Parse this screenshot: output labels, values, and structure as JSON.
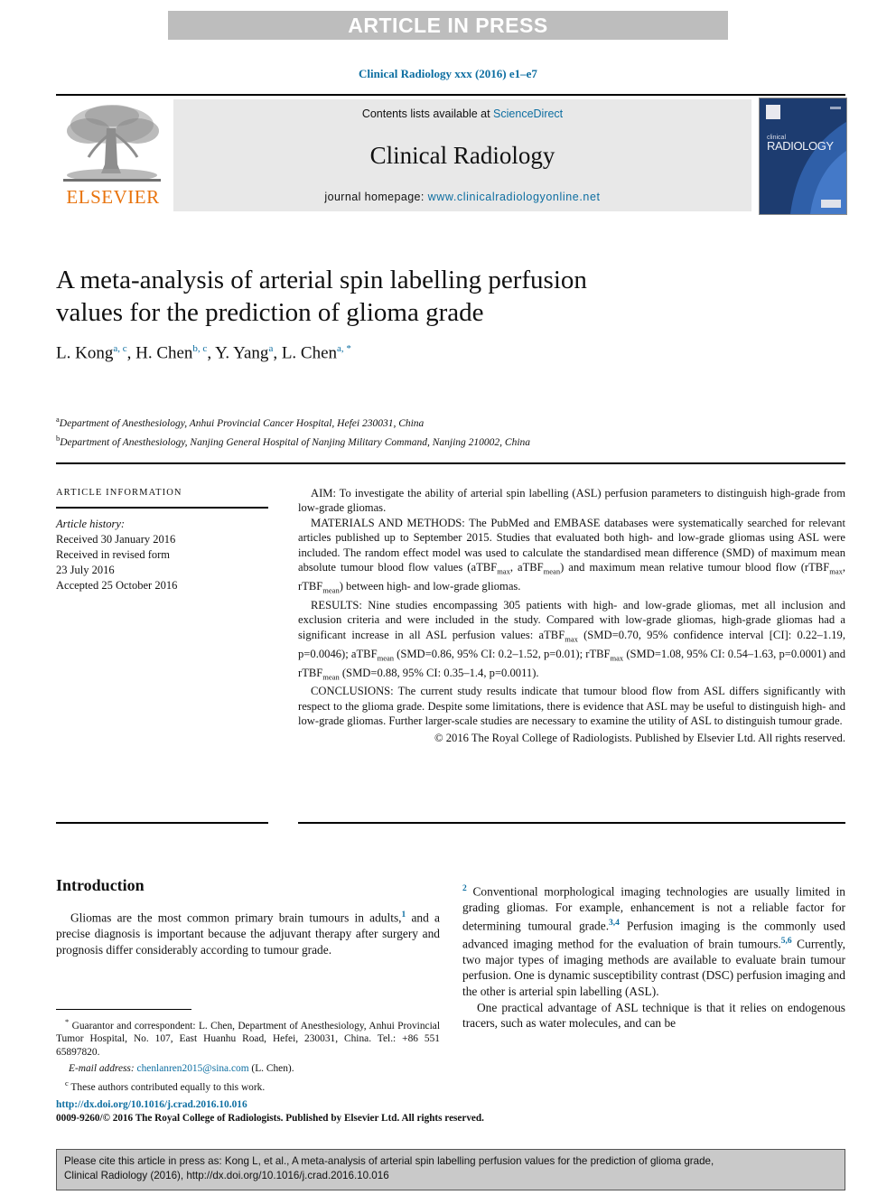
{
  "banner": {
    "label": "ARTICLE IN PRESS"
  },
  "running_head": "Clinical Radiology xxx (2016) e1–e7",
  "masthead": {
    "contents_prefix": "Contents lists available at ",
    "sciencedirect": "ScienceDirect",
    "journal_name": "Clinical Radiology",
    "homepage_prefix": "journal homepage: ",
    "homepage_url": "www.clinicalradiologyonline.net",
    "elsevier_wordmark": "ELSEVIER",
    "cover_title_top": "clinical",
    "cover_title_main": "RADIOLOGY",
    "link_color": "#0d6ea1",
    "elsevier_orange": "#e8730d"
  },
  "article": {
    "title": "A meta-analysis of arterial spin labelling perfusion values for the prediction of glioma grade",
    "authors": [
      {
        "name": "L. Kong",
        "marks": "a, c",
        "sep": ", "
      },
      {
        "name": "H. Chen",
        "marks": "b, c",
        "sep": ", "
      },
      {
        "name": "Y. Yang",
        "marks": "a",
        "sep": ", "
      },
      {
        "name": "L. Chen",
        "marks": "a, *",
        "sep": ""
      }
    ],
    "affiliations": [
      {
        "mark": "a",
        "text": "Department of Anesthesiology, Anhui Provincial Cancer Hospital, Hefei 230031, China"
      },
      {
        "mark": "b",
        "text": "Department of Anesthesiology, Nanjing General Hospital of Nanjing Military Command, Nanjing 210002, China"
      }
    ]
  },
  "article_information": {
    "heading": "Article information",
    "history_label": "Article history:",
    "history": [
      "Received 30 January 2016",
      "Received in revised form",
      "23 July 2016",
      "Accepted 25 October 2016"
    ]
  },
  "abstract": {
    "aim_label": "AIM:",
    "aim_text": " To investigate the ability of arterial spin labelling (ASL) perfusion parameters to distinguish high-grade from low-grade gliomas.",
    "methods_label": "MATERIALS AND METHODS:",
    "methods_text_1": " The PubMed and EMBASE databases were systematically searched for relevant articles published up to September 2015. Studies that evaluated both high- and low-grade gliomas using ASL were included. The random effect model was used to calculate the standardised mean difference (SMD) of maximum mean absolute tumour blood flow values (aTBF",
    "methods_sub_1": "max",
    "methods_text_2": ", aTBF",
    "methods_sub_2": "mean",
    "methods_text_3": ") and maximum mean relative tumour blood flow (rTBF",
    "methods_sub_3": "max",
    "methods_text_4": ", rTBF",
    "methods_sub_4": "mean",
    "methods_text_5": ") between high- and low-grade gliomas.",
    "results_label": "RESULTS:",
    "results_text_1": " Nine studies encompassing 305 patients with high- and low-grade gliomas, met all inclusion and exclusion criteria and were included in the study. Compared with low-grade gliomas, high-grade gliomas had a significant increase in all ASL perfusion values: aTBF",
    "results_sub_1": "max",
    "results_text_2": " (SMD=0.70, 95% confidence interval [CI]: 0.22–1.19, p=0.0046); aTBF",
    "results_sub_2": "mean",
    "results_text_3": " (SMD=0.86, 95% CI: 0.2–1.52, p=0.01); rTBF",
    "results_sub_3": "max",
    "results_text_4": " (SMD=1.08, 95% CI: 0.54–1.63, p=0.0001) and rTBF",
    "results_sub_4": "mean",
    "results_text_5": " (SMD=0.88, 95% CI: 0.35–1.4, p=0.0011).",
    "conclusions_label": "CONCLUSIONS:",
    "conclusions_text": " The current study results indicate that tumour blood flow from ASL differs significantly with respect to the glioma grade. Despite some limitations, there is evidence that ASL may be useful to distinguish high- and low-grade gliomas. Further larger-scale studies are necessary to examine the utility of ASL to distinguish tumour grade.",
    "copyright": "© 2016 The Royal College of Radiologists. Published by Elsevier Ltd. All rights reserved."
  },
  "introduction": {
    "heading": "Introduction",
    "para1_a": "Gliomas are the most common primary brain tumours in adults,",
    "para1_ref1": "1",
    "para1_b": " and a precise diagnosis is important because the adjuvant therapy after surgery and prognosis differ considerably according to tumour grade.",
    "para1_ref2": "2",
    "para1_c": " Conventional morphological imaging technologies are usually limited in grading gliomas. For example, enhancement is not a reliable factor for determining tumoural grade.",
    "para1_ref3": "3,4",
    "para1_d": " Perfusion imaging is the commonly used advanced imaging method for the evaluation of brain tumours.",
    "para1_ref4": "5,6",
    "para1_e": " Currently, two major types of imaging methods are available to evaluate brain tumour perfusion. One is dynamic susceptibility contrast (DSC) perfusion imaging and the other is arterial spin labelling (ASL).",
    "para2": "One practical advantage of ASL technique is that it relies on endogenous tracers, such as water molecules, and can be"
  },
  "footnotes": {
    "star_mark": "*",
    "star_text": " Guarantor and correspondent: L. Chen, Department of Anesthesiology, Anhui Provincial Tumor Hospital, No. 107, East Huanhu Road, Hefei, 230031, China. Tel.: +86 551 65897820.",
    "email_label": "E-mail address:",
    "email_address": "chenlanren2015@sina.com",
    "email_suffix": " (L. Chen).",
    "c_mark": "c",
    "c_text": " These authors contributed equally to this work."
  },
  "footer": {
    "doi_url": "http://dx.doi.org/10.1016/j.crad.2016.10.016",
    "issn_line": "0009-9260/© 2016 The Royal College of Radiologists. Published by Elsevier Ltd. All rights reserved."
  },
  "cite_box": {
    "line1": "Please cite this article in press as: Kong L, et al., A meta-analysis of arterial spin labelling perfusion values for the prediction of glioma grade,",
    "line2": "Clinical Radiology (2016), http://dx.doi.org/10.1016/j.crad.2016.10.016"
  }
}
